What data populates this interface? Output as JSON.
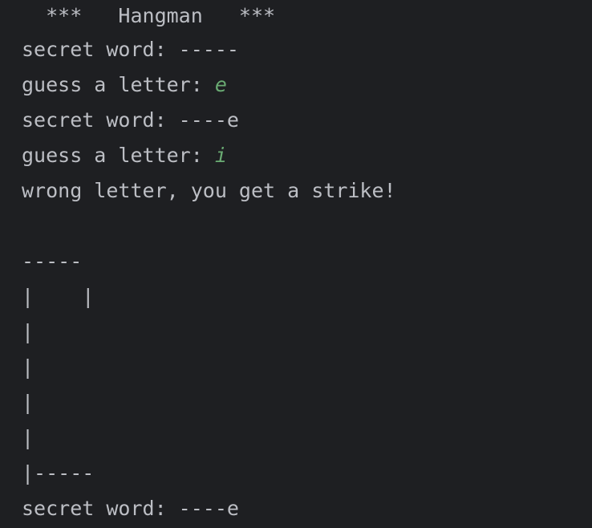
{
  "console": {
    "title": "  ***   Hangman   ***",
    "lines": [
      {
        "text": "secret word: -----",
        "input": ""
      },
      {
        "text": "guess a letter: ",
        "input": "e"
      },
      {
        "text": "secret word: ----e",
        "input": ""
      },
      {
        "text": "guess a letter: ",
        "input": "i"
      },
      {
        "text": "wrong letter, you get a strike!",
        "input": ""
      },
      {
        "text": "",
        "input": ""
      },
      {
        "text": "-----",
        "input": ""
      },
      {
        "text": "|    |",
        "input": ""
      },
      {
        "text": "|",
        "input": ""
      },
      {
        "text": "|",
        "input": ""
      },
      {
        "text": "|",
        "input": ""
      },
      {
        "text": "|",
        "input": ""
      },
      {
        "text": "|-----",
        "input": ""
      },
      {
        "text": "secret word: ----e",
        "input": ""
      }
    ]
  },
  "colors": {
    "background": "#1e1f22",
    "output_text": "#bcbec4",
    "user_input": "#6aab73"
  }
}
